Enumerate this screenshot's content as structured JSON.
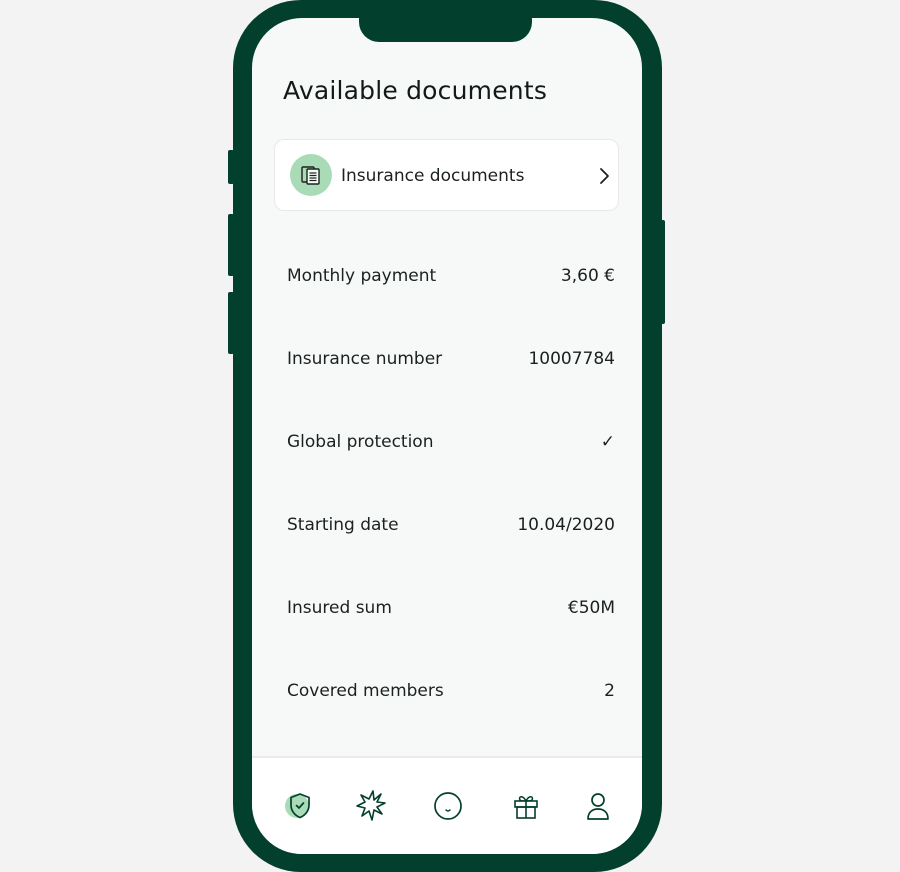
{
  "page": {
    "title": "Available documents"
  },
  "documents_card": {
    "label": "Insurance documents",
    "icon": "documents-icon",
    "chevron": "chevron-right-icon"
  },
  "details": [
    {
      "label": "Monthly payment",
      "value": "3,60 €"
    },
    {
      "label": "Insurance number",
      "value": "10007784"
    },
    {
      "label": "Global protection",
      "value": "✓"
    },
    {
      "label": "Starting date",
      "value": "10.04/2020"
    },
    {
      "label": "Insured sum",
      "value": "€50M"
    },
    {
      "label": "Covered members",
      "value": "2"
    }
  ],
  "tabbar": {
    "items": [
      {
        "icon": "shield-check-icon",
        "active": true
      },
      {
        "icon": "sparkle-icon",
        "active": false
      },
      {
        "icon": "smiley-icon",
        "active": false
      },
      {
        "icon": "gift-icon",
        "active": false
      },
      {
        "icon": "profile-icon",
        "active": false
      }
    ]
  },
  "colors": {
    "phone_frame": "#033f2d",
    "accent": "#a9dcb6",
    "screen_bg": "#f7f9f8",
    "text": "#1b211e"
  }
}
